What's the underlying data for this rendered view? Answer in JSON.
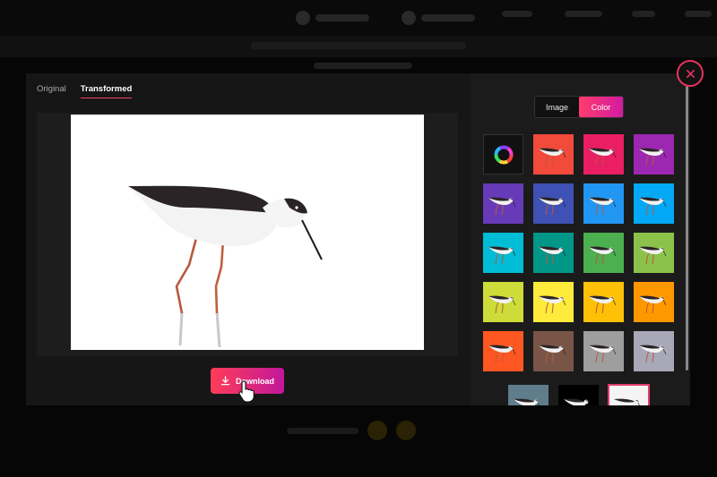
{
  "tabs": [
    {
      "label": "Original",
      "active": false
    },
    {
      "label": "Transformed",
      "active": true
    }
  ],
  "download": {
    "label": "Download",
    "icon": "download-icon"
  },
  "toggle": {
    "image_label": "Image",
    "color_label": "Color",
    "selected": "Color"
  },
  "swatches": [
    {
      "type": "color-picker",
      "icon": "color-wheel-icon"
    },
    {
      "color": "#f24a3b"
    },
    {
      "color": "#e91e63"
    },
    {
      "color": "#9c27b0"
    },
    {
      "color": "#673ab7"
    },
    {
      "color": "#3f51b5"
    },
    {
      "color": "#2196f3"
    },
    {
      "color": "#03a9f4"
    },
    {
      "color": "#00bcd4"
    },
    {
      "color": "#009688"
    },
    {
      "color": "#4caf50"
    },
    {
      "color": "#8bc34a"
    },
    {
      "color": "#cddc39"
    },
    {
      "color": "#ffeb3b"
    },
    {
      "color": "#ffc107"
    },
    {
      "color": "#ff9800"
    },
    {
      "color": "#ff5722"
    },
    {
      "color": "#795548"
    },
    {
      "color": "#9e9e9e"
    },
    {
      "color": "#a8a8b8"
    }
  ],
  "last_row_swatches": [
    {
      "color": "#607d8b"
    },
    {
      "color": "#000000"
    },
    {
      "color": "#ffffff",
      "selected": true
    }
  ],
  "accent": "#ff3d6e",
  "close": {
    "icon": "close-icon"
  }
}
